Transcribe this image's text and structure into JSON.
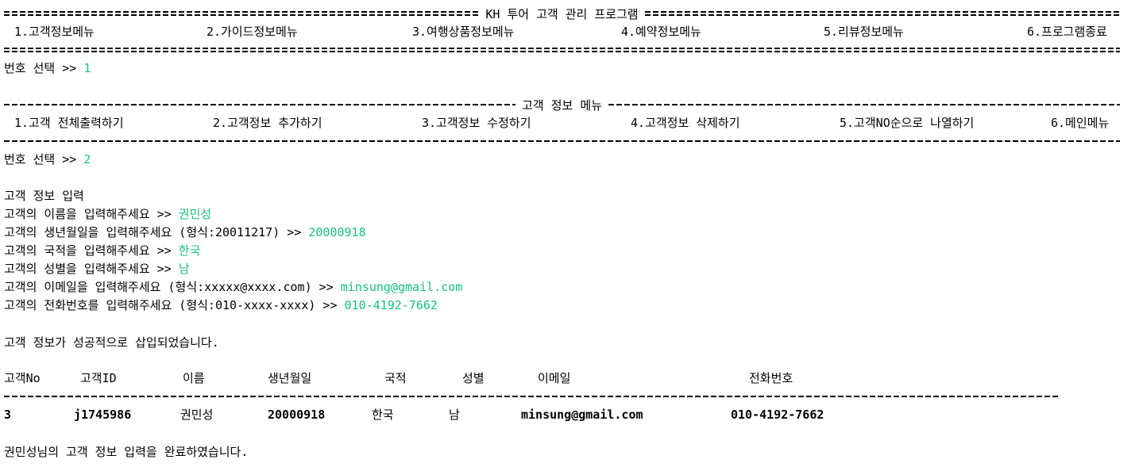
{
  "main_menu": {
    "title": "KH 투어 고객 관리 프로그램",
    "items": [
      "1.고객정보메뉴",
      "2.가이드정보메뉴",
      "3.여행상품정보메뉴",
      "4.예약정보메뉴",
      "5.리뷰정보메뉴",
      "6.프로그램종료"
    ]
  },
  "prompt1": {
    "label": "번호 선택 >> ",
    "value": "1"
  },
  "customer_menu": {
    "title": "고객 정보 메뉴",
    "items": [
      "1.고객 전체출력하기",
      "2.고객정보 추가하기",
      "3.고객정보 수정하기",
      "4.고객정보 삭제하기",
      "5.고객NO순으로 나열하기",
      "6.메인메뉴"
    ]
  },
  "prompt2": {
    "label": "번호 선택 >> ",
    "value": "2"
  },
  "input_header": "고객 정보 입력",
  "inputs": [
    {
      "label": "고객의 이름을 입력해주세요 >> ",
      "value": "권민성"
    },
    {
      "label": "고객의 생년월일을 입력해주세요 (형식:20011217) >> ",
      "value": "20000918"
    },
    {
      "label": "고객의 국적을 입력해주세요 >> ",
      "value": "한국"
    },
    {
      "label": "고객의 성별을 입력해주세요 >> ",
      "value": "남"
    },
    {
      "label": "고객의 이메일을 입력해주세요 (형식:xxxxx@xxxx.com) >> ",
      "value": "minsung@gmail.com"
    },
    {
      "label": "고객의 전화번호를 입력해주세요 (형식:010-xxxx-xxxx) >> ",
      "value": "010-4192-7662"
    }
  ],
  "success_msg": "고객 정보가 성공적으로 삽입되었습니다.",
  "table": {
    "headers": [
      "고객No",
      "고객ID",
      "이름",
      "생년월일",
      "국적",
      "성별",
      "이메일",
      "전화번호"
    ],
    "rows": [
      [
        "3",
        "j1745986",
        "권민성",
        "20000918",
        "한국",
        "남",
        "minsung@gmail.com",
        "010-4192-7662"
      ]
    ]
  },
  "complete_msg": "권민성님의 고객 정보 입력을 완료하였습니다.",
  "colors": {
    "input": "#13c47f"
  }
}
